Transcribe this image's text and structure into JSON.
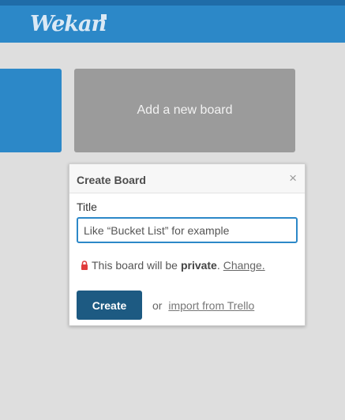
{
  "header": {
    "logo_text": "Wekan"
  },
  "boards": {
    "add_board_label": "Add a new board"
  },
  "popup": {
    "title": "Create Board",
    "close_symbol": "×",
    "field_label": "Title",
    "input_placeholder": "Like “Bucket List” for example",
    "input_value": "",
    "privacy_prefix": "This board will be",
    "privacy_value": "private",
    "privacy_suffix": ".",
    "change_link": "Change.",
    "create_button": "Create",
    "or_text": "or",
    "import_link": "import from Trello"
  },
  "colors": {
    "header": "#2c88c8",
    "board_tile": "#2c88c8",
    "add_board_tile": "#9b9b9b",
    "create_button": "#1d5a82",
    "lock_icon": "#e03b3b"
  },
  "icons": [
    "logo",
    "close-icon",
    "lock-icon"
  ]
}
